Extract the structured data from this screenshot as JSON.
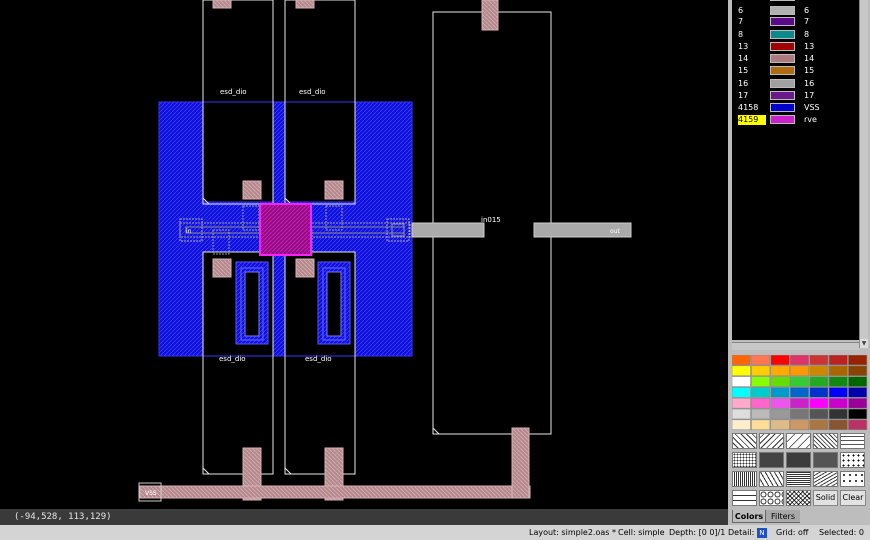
{
  "canvas": {
    "cells": [
      {
        "name": "esd_dio"
      },
      {
        "name": "esd_dio"
      },
      {
        "name": "esd_dio"
      },
      {
        "name": "esd_dio"
      },
      {
        "name": "in015"
      }
    ],
    "pins": {
      "in": "in",
      "out": "out",
      "vss": "VSS"
    }
  },
  "coords": {
    "text": "(-94,528, 113,129)"
  },
  "layers": [
    {
      "num": "6",
      "name": "6",
      "color": "#b0b0b0"
    },
    {
      "num": "7",
      "name": "7",
      "color": "#5a0a8a"
    },
    {
      "num": "8",
      "name": "8",
      "color": "#0a8a8a"
    },
    {
      "num": "13",
      "name": "13",
      "color": "#a00000"
    },
    {
      "num": "14",
      "name": "14",
      "color": "#b07880"
    },
    {
      "num": "15",
      "name": "15",
      "color": "#b06a10"
    },
    {
      "num": "16",
      "name": "16",
      "color": "#a0a0a0"
    },
    {
      "num": "17",
      "name": "17",
      "color": "#6a1a8a"
    },
    {
      "num": "4158",
      "name": "VSS",
      "color": "#0000cc"
    },
    {
      "num": "4159",
      "name": "rve",
      "color": "#cc22cc",
      "selected": true
    }
  ],
  "palette": [
    [
      "#ff6600",
      "#ff7755",
      "#ff0000",
      "#dd3366",
      "#cc3333",
      "#bb2222",
      "#992200"
    ],
    [
      "#ffff00",
      "#ffcc00",
      "#ffaa00",
      "#ff9900",
      "#cc8800",
      "#aa6600",
      "#884400"
    ],
    [
      "#ffffff",
      "#88ff00",
      "#66dd00",
      "#33cc33",
      "#22aa22",
      "#118811",
      "#006600"
    ],
    [
      "#00ffff",
      "#00cccc",
      "#0099cc",
      "#0066cc",
      "#0033cc",
      "#0000ff",
      "#0000aa"
    ],
    [
      "#ffaacc",
      "#ff66cc",
      "#ee55ee",
      "#cc22cc",
      "#ff00ff",
      "#cc00cc",
      "#990099"
    ],
    [
      "#dddddd",
      "#bbbbbb",
      "#999999",
      "#777777",
      "#555555",
      "#333333",
      "#000000"
    ],
    [
      "#ffeecc",
      "#ffdd99",
      "#ddbb88",
      "#cc9966",
      "#aa7744",
      "#885533",
      "#bb3366"
    ]
  ],
  "panel": {
    "solid_label": "Solid",
    "clear_label": "Clear",
    "tabs": [
      "Colors",
      "Filters"
    ]
  },
  "status": {
    "layout": "Layout: simple2.oas *",
    "cell": "Cell: simple",
    "depth": "Depth: [0 0]/1",
    "detail_label": "Detail:",
    "detail_icon": "N",
    "grid": "Grid: off",
    "selected": "Selected: 0"
  },
  "colors": {
    "vss_blue": "#1010dd",
    "highlight_magenta": "#ff22ff",
    "contact_pink": "#b48a8e",
    "gray_pin": "#aaaaaa"
  }
}
